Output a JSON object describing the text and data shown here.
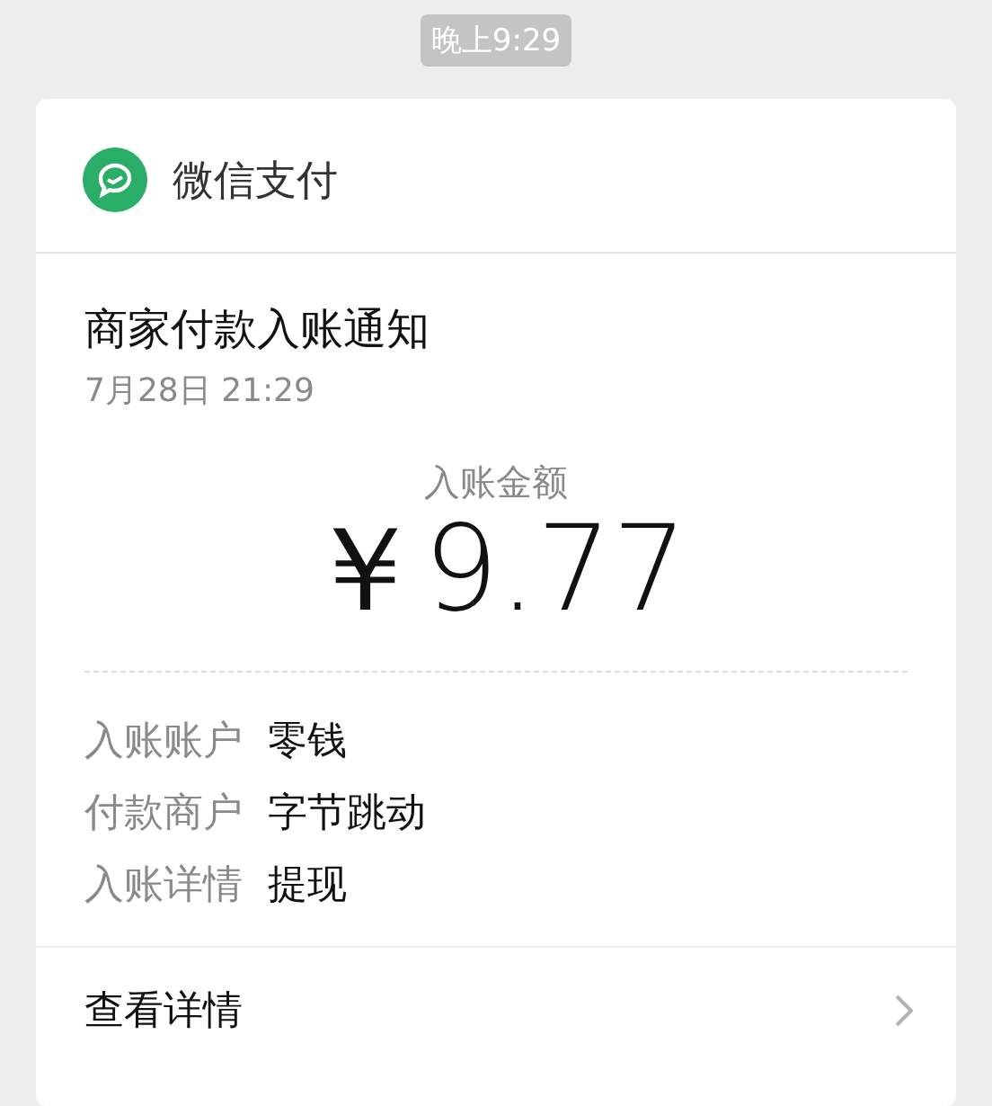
{
  "timestamp": "晚上9:29",
  "card": {
    "app_name": "微信支付",
    "title": "商家付款入账通知",
    "date": "7月28日  21:29",
    "amount_label": "入账金额",
    "amount": "￥9.77",
    "details": [
      {
        "label": "入账账户",
        "value": "零钱"
      },
      {
        "label": "付款商户",
        "value": "字节跳动"
      },
      {
        "label": "入账详情",
        "value": "提现"
      }
    ],
    "link": "查看详情"
  }
}
